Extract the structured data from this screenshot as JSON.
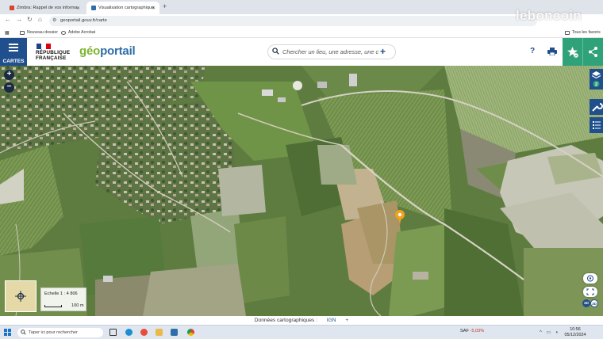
{
  "browser": {
    "tabs": [
      {
        "label": "Zimbra: Rappel de vos informa"
      },
      {
        "label": "Visualisation cartographique"
      }
    ],
    "url": "geoportail.gouv.fr/carte",
    "bookmarks": [
      {
        "label": "Nouveau dossier"
      },
      {
        "label": "Adobe Acrobat"
      },
      {
        "label": "Tous les favoris"
      }
    ]
  },
  "header": {
    "menu_label": "CARTES",
    "republique_line1": "RÉPUBLIQUE",
    "republique_line2": "FRANÇAISE",
    "logo_geo": "géo",
    "logo_portail": "portail",
    "search_placeholder": "Chercher un lieu, une adresse, une c",
    "help_label": "?"
  },
  "map": {
    "scale_label": "Echelle 1 : 4 806",
    "scale_length": "100 m",
    "view_2d": "2D",
    "view_3d": "3D",
    "layers_count": "2",
    "marker_color": "#f0a21c"
  },
  "attribution": {
    "text": "Données cartographiques :",
    "provider": "IGN"
  },
  "taskbar": {
    "search_placeholder": "Taper ici pour rechercher",
    "stock_name": "SAF",
    "stock_change": "-5,03%",
    "time": "10:56",
    "date": "05/12/2024"
  },
  "watermark": "leboncoin",
  "colors": {
    "brand_blue": "#1f4f8c",
    "share_green": "#2fa27a"
  }
}
